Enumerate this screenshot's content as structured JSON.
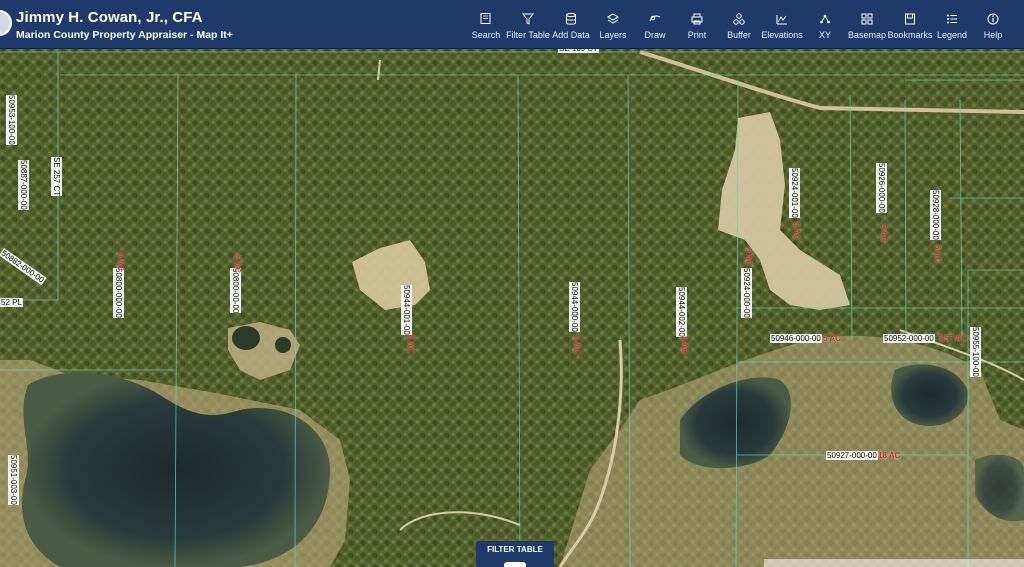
{
  "header": {
    "title": "Jimmy H. Cowan, Jr., CFA",
    "subtitle": "Marion County Property Appraiser - Map It+"
  },
  "toolbar": [
    {
      "label": "Search",
      "icon": "search-icon"
    },
    {
      "label": "Filter Table",
      "icon": "filter-icon"
    },
    {
      "label": "Add Data",
      "icon": "database-icon"
    },
    {
      "label": "Layers",
      "icon": "layers-icon"
    },
    {
      "label": "Draw",
      "icon": "draw-icon"
    },
    {
      "label": "Print",
      "icon": "printer-icon"
    },
    {
      "label": "Buffer",
      "icon": "buffer-icon"
    },
    {
      "label": "Elevations",
      "icon": "elevation-icon"
    },
    {
      "label": "XY",
      "icon": "xy-icon"
    },
    {
      "label": "Basemap",
      "icon": "basemap-icon"
    },
    {
      "label": "Bookmarks",
      "icon": "bookmark-icon"
    },
    {
      "label": "Legend",
      "icon": "legend-icon"
    },
    {
      "label": "Help",
      "icon": "help-icon"
    }
  ],
  "map": {
    "parcel_labels": [
      {
        "text": "50946-000-00"
      },
      {
        "text": "50952-000-00"
      },
      {
        "text": "50927-000-00"
      },
      {
        "text": "50924-000-00"
      },
      {
        "text": "50924-001-00"
      },
      {
        "text": "50926-000-00"
      },
      {
        "text": "50928-000-00"
      },
      {
        "text": "50944-001-00"
      },
      {
        "text": "50944-000-00"
      },
      {
        "text": "50944-002-00"
      },
      {
        "text": "50800-000-00"
      },
      {
        "text": "50800-00-00"
      },
      {
        "text": "50887-000-00"
      },
      {
        "text": "50882-000-00"
      },
      {
        "text": "50953-100-00"
      },
      {
        "text": "50951-003-00"
      },
      {
        "text": "50955-100-00"
      }
    ],
    "acre_labels": [
      "5 AC",
      "3.57 AC",
      "18 AC",
      "5 AC",
      "5 AC",
      "5 AC",
      "5 AC",
      "5 AC",
      "5 AC",
      "5 AC",
      "5 AC",
      "5 AC"
    ],
    "street_labels": [
      "SE 257 CT",
      "52 PL"
    ],
    "top_street_partial": "SE 109 ST"
  },
  "filter_tab": {
    "label": "FILTER TABLE"
  },
  "colors": {
    "header_bg": "#1f3a6a",
    "parcel_line": "#5fd3c4",
    "acre_text": "#d2302c"
  }
}
